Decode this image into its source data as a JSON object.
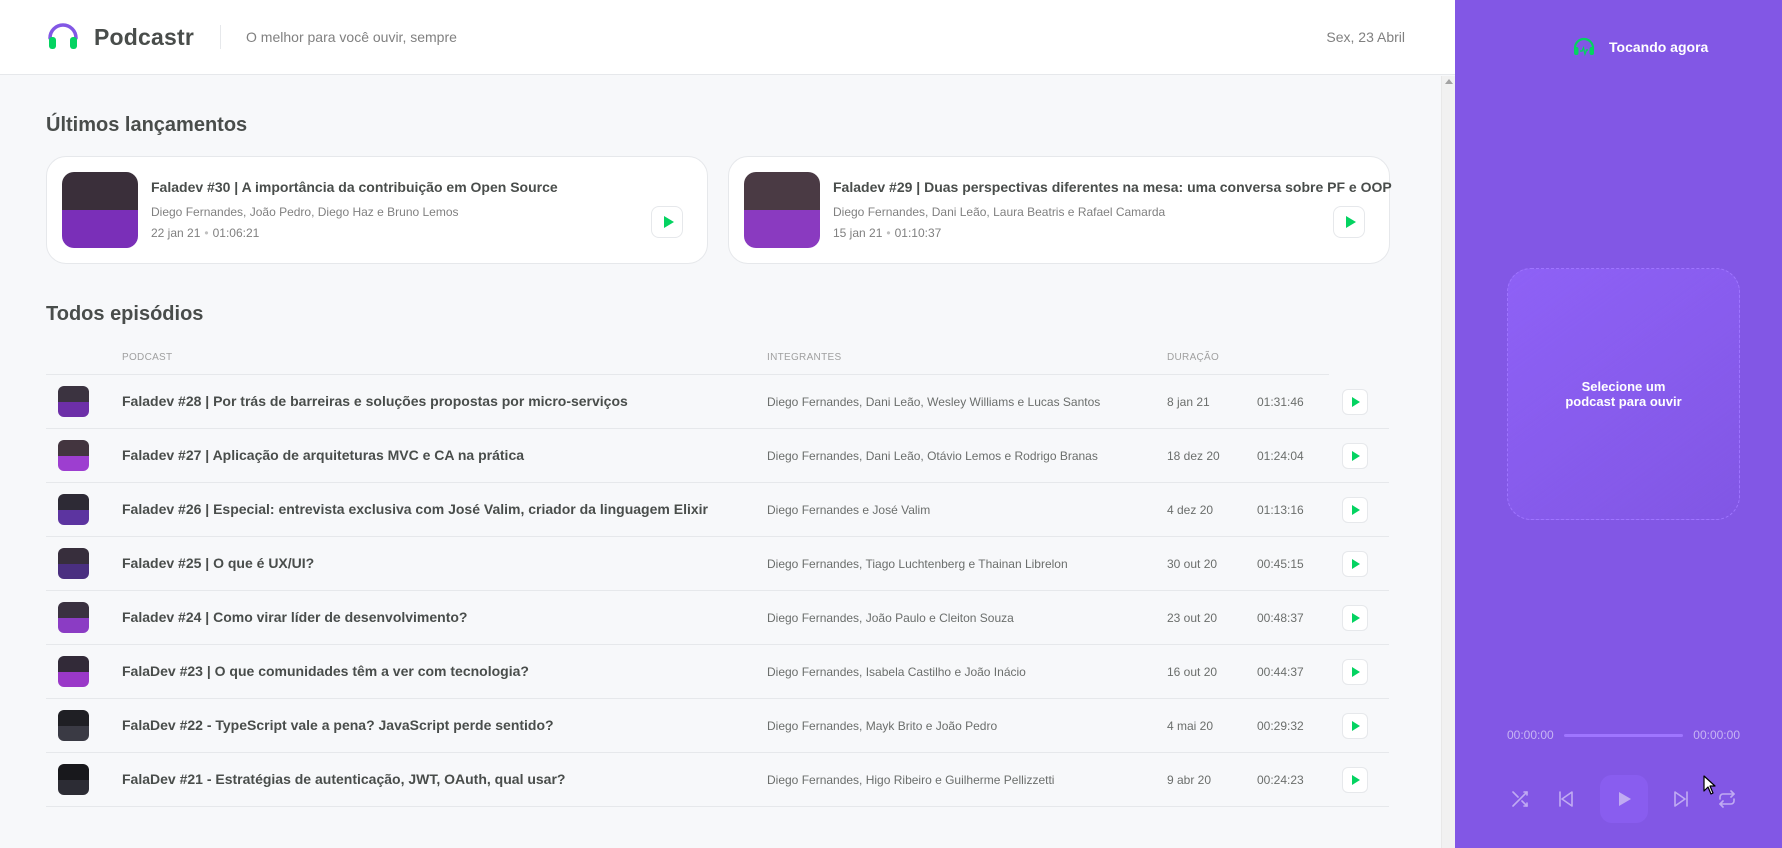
{
  "header": {
    "app_name": "Podcastr",
    "tagline": "O melhor para você ouvir, sempre",
    "date": "Sex, 23 Abril"
  },
  "latest": {
    "title": "Últimos lançamentos",
    "episodes": [
      {
        "title": "Faladev #30 | A importância da contribuição em Open Source",
        "members": "Diego Fernandes, João Pedro, Diego Haz e Bruno Lemos",
        "date": "22 jan 21",
        "duration": "01:06:21",
        "thumb_colors": [
          "#3a2f3a",
          "#7a2fb8"
        ]
      },
      {
        "title": "Faladev #29 | Duas perspectivas diferentes na mesa: uma conversa sobre PF e OOP",
        "members": "Diego Fernandes, Dani Leão, Laura Beatris e Rafael Camarda",
        "date": "15 jan 21",
        "duration": "01:10:37",
        "thumb_colors": [
          "#4a3a44",
          "#8a3ac0"
        ]
      }
    ]
  },
  "all": {
    "title": "Todos episódios",
    "columns": {
      "podcast": "PODCAST",
      "members": "INTEGRANTES",
      "duration": "DURAÇÃO"
    },
    "episodes": [
      {
        "title": "Faladev #28 | Por trás de barreiras e soluções propostas por micro-serviços",
        "members": "Diego Fernandes, Dani Leão, Wesley Williams e Lucas Santos",
        "date": "8 jan 21",
        "duration": "01:31:46",
        "thumb_colors": [
          "#3b3340",
          "#6d2fa8"
        ]
      },
      {
        "title": "Faladev #27 | Aplicação de arquiteturas MVC e CA na prática",
        "members": "Diego Fernandes, Dani Leão, Otávio Lemos e Rodrigo Branas",
        "date": "18 dez 20",
        "duration": "01:24:04",
        "thumb_colors": [
          "#43353f",
          "#9d3ed0"
        ]
      },
      {
        "title": "Faladev #26 | Especial: entrevista exclusiva com José Valim, criador da linguagem Elixir",
        "members": "Diego Fernandes e José Valim",
        "date": "4 dez 20",
        "duration": "01:13:16",
        "thumb_colors": [
          "#2d2a35",
          "#5c34a0"
        ]
      },
      {
        "title": "Faladev #25 | O que é UX/UI?",
        "members": "Diego Fernandes, Tiago Luchtenberg e Thainan Librelon",
        "date": "30 out 20",
        "duration": "00:45:15",
        "thumb_colors": [
          "#372e3c",
          "#4a2f80"
        ]
      },
      {
        "title": "Faladev #24 | Como virar líder de desenvolvimento?",
        "members": "Diego Fernandes, João Paulo e Cleiton Souza",
        "date": "23 out 20",
        "duration": "00:48:37",
        "thumb_colors": [
          "#3a3140",
          "#8b3cc4"
        ]
      },
      {
        "title": "FalaDev #23 | O que comunidades têm a ver com tecnologia?",
        "members": "Diego Fernandes, Isabela Castilho e João Inácio",
        "date": "16 out 20",
        "duration": "00:44:37",
        "thumb_colors": [
          "#322a38",
          "#9a38c8"
        ]
      },
      {
        "title": "FalaDev #22 - TypeScript vale a pena? JavaScript perde sentido?",
        "members": "Diego Fernandes, Mayk Brito e João Pedro",
        "date": "4 mai 20",
        "duration": "00:29:32",
        "thumb_colors": [
          "#1f1f24",
          "#3a3a44"
        ]
      },
      {
        "title": "FalaDev #21 - Estratégias de autenticação, JWT, OAuth, qual usar?",
        "members": "Diego Fernandes, Higo Ribeiro e Guilherme Pellizzetti",
        "date": "9 abr 20",
        "duration": "00:24:23",
        "thumb_colors": [
          "#18181c",
          "#2c2c34"
        ]
      }
    ]
  },
  "player": {
    "now_playing": "Tocando agora",
    "empty_message": "Selecione um podcast para ouvir",
    "current_time": "00:00:00",
    "total_time": "00:00:00",
    "progress_fraction": 0,
    "controls": [
      "shuffle-icon",
      "previous-icon",
      "play-icon",
      "next-icon",
      "repeat-icon"
    ]
  },
  "colors": {
    "accent_purple": "#8257e5",
    "play_green": "#04d361",
    "headphone_purple": "#6f4bd8"
  }
}
